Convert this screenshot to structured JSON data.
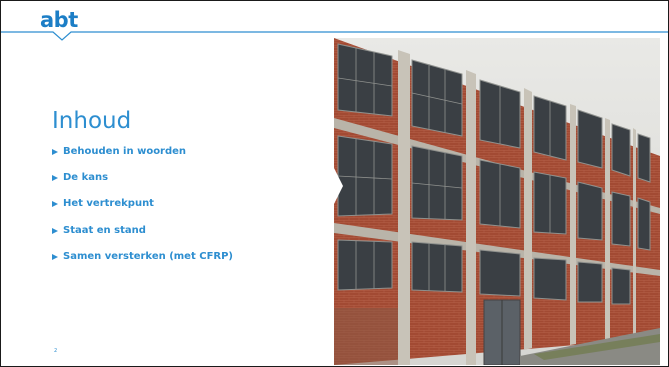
{
  "brand": {
    "logo_text": "abt",
    "accent_color": "#2d8ed0",
    "logo_color": "#1c7ec6"
  },
  "slide": {
    "title": "Inhoud",
    "agenda": [
      "Behouden in woorden",
      "De kans",
      "Het vertrekpunt",
      "Staat en stand",
      "Samen versterken (met CFRP)"
    ],
    "page_number": "2",
    "photo": {
      "subject": "brick-factory-building-icon"
    }
  }
}
